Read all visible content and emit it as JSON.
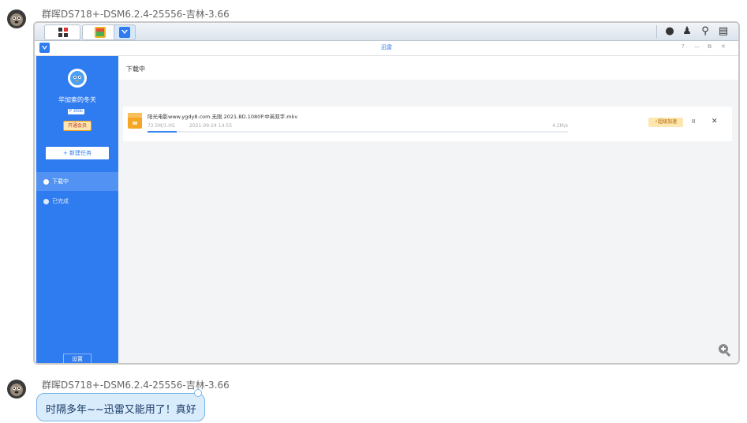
{
  "posts": [
    {
      "sender": "群晖DS718+-DSM6.2.4-25556-吉林-3.66"
    },
    {
      "sender": "群晖DS718+-DSM6.2.4-25556-吉林-3.66",
      "message": "时隔多年~~迅雷又能用了！真好"
    }
  ],
  "window": {
    "title": "迅雷",
    "help": "?",
    "minimize": "—",
    "restore": "⧉",
    "close": "✕"
  },
  "sidebar": {
    "username": "华加索的冬天",
    "vip_badge": "P 360k",
    "vip_button": "开通会员",
    "new_task": "+ 新建任务",
    "nav": [
      {
        "label": "下载中",
        "active": true
      },
      {
        "label": "已完成",
        "active": false
      }
    ],
    "settings": "设置"
  },
  "main": {
    "heading": "下载中",
    "task": {
      "name": "阳光电影www.ygdy8.com.无限.2021.BD.1080P.中英双字.mkv",
      "size": "72.5M/1.0G",
      "date": "2021-09-24 14:55",
      "speed": "4.2M/s",
      "progress": 0.07,
      "boost": "超级加速",
      "pause": "II",
      "remove": "✕"
    }
  },
  "colors": {
    "accent": "#2f7bf0",
    "progress": "#3b86f0",
    "boost_bg": "#fde7b0"
  }
}
